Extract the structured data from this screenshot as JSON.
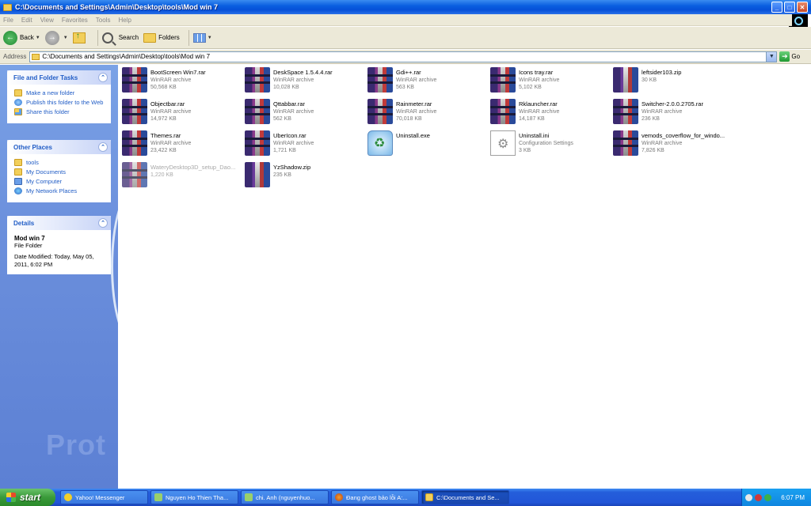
{
  "window": {
    "title": "C:\\Documents and Settings\\Admin\\Desktop\\tools\\Mod win 7",
    "controls": {
      "minimize": "_",
      "maximize": "□",
      "close": "✕"
    }
  },
  "menu": [
    "File",
    "Edit",
    "View",
    "Favorites",
    "Tools",
    "Help"
  ],
  "toolbar": {
    "back": "Back",
    "search": "Search",
    "folders": "Folders"
  },
  "address": {
    "label": "Address",
    "value": "C:\\Documents and Settings\\Admin\\Desktop\\tools\\Mod win 7",
    "go": "Go"
  },
  "taskpane": {
    "file_folder_tasks": {
      "title": "File and Folder Tasks",
      "items": [
        "Make a new folder",
        "Publish this folder to the Web",
        "Share this folder"
      ]
    },
    "other_places": {
      "title": "Other Places",
      "items": [
        "tools",
        "My Documents",
        "My Computer",
        "My Network Places"
      ]
    },
    "details": {
      "title": "Details",
      "name": "Mod win 7",
      "type": "File Folder",
      "modified": "Date Modified: Today, May 05, 2011, 6:02 PM"
    },
    "watermark": "Prot"
  },
  "files": [
    {
      "name": "BootScreen Win7.rar",
      "type": "WinRAR archive",
      "size": "50,568 KB",
      "icon": "winrar-archive-icon"
    },
    {
      "name": "DeskSpace 1.5.4.4.rar",
      "type": "WinRAR archive",
      "size": "10,028 KB",
      "icon": "winrar-archive-icon"
    },
    {
      "name": "Gdi++.rar",
      "type": "WinRAR archive",
      "size": "563 KB",
      "icon": "winrar-archive-icon"
    },
    {
      "name": "Icons tray.rar",
      "type": "WinRAR archive",
      "size": "5,102 KB",
      "icon": "winrar-archive-icon"
    },
    {
      "name": "leftsider103.zip",
      "type": "",
      "size": "30 KB",
      "icon": "zip-archive-icon"
    },
    {
      "name": "Objectbar.rar",
      "type": "WinRAR archive",
      "size": "14,972 KB",
      "icon": "winrar-archive-icon"
    },
    {
      "name": "Qttabbar.rar",
      "type": "WinRAR archive",
      "size": "562 KB",
      "icon": "winrar-archive-icon"
    },
    {
      "name": "Rainmeter.rar",
      "type": "WinRAR archive",
      "size": "70,018 KB",
      "icon": "winrar-archive-icon"
    },
    {
      "name": "Rklauncher.rar",
      "type": "WinRAR archive",
      "size": "14,187 KB",
      "icon": "winrar-archive-icon"
    },
    {
      "name": "Switcher-2.0.0.2705.rar",
      "type": "WinRAR archive",
      "size": "236 KB",
      "icon": "winrar-archive-icon"
    },
    {
      "name": "Themes.rar",
      "type": "WinRAR archive",
      "size": "23,422 KB",
      "icon": "winrar-archive-icon"
    },
    {
      "name": "UberIcon.rar",
      "type": "WinRAR archive",
      "size": "1,721 KB",
      "icon": "winrar-archive-icon"
    },
    {
      "name": "Uninstall.exe",
      "type": "",
      "size": "",
      "icon": "uninstaller-icon"
    },
    {
      "name": "Uninstall.ini",
      "type": "Configuration Settings",
      "size": "3 KB",
      "icon": "config-file-icon"
    },
    {
      "name": "vemods_coverflow_for_windo...",
      "type": "WinRAR archive",
      "size": "7,826 KB",
      "icon": "winrar-archive-icon"
    },
    {
      "name": "WateryDesktop3D_setup_Dao...",
      "type": "",
      "size": "1,220 KB",
      "icon": "winrar-archive-icon"
    },
    {
      "name": "YzShadow.zip",
      "type": "",
      "size": "235 KB",
      "icon": "zip-archive-icon"
    }
  ],
  "taskbar": {
    "start": "start",
    "items": [
      {
        "label": "Yahoo! Messenger",
        "icon": "yahoo-messenger-icon"
      },
      {
        "label": "Nguyen Ho Thien Tha...",
        "icon": "chat-icon"
      },
      {
        "label": "chi. Anh (nguyenhuo...",
        "icon": "chat-icon"
      },
      {
        "label": "Đang ghost bảo lỗi A:...",
        "icon": "firefox-icon"
      },
      {
        "label": "C:\\Documents and Se...",
        "icon": "folder-icon"
      }
    ],
    "clock": "6:07 PM"
  }
}
